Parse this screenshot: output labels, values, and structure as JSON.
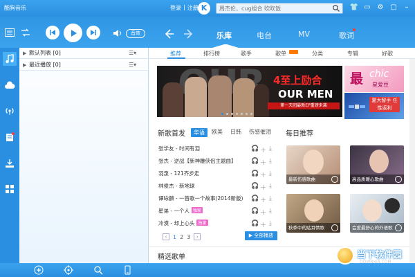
{
  "window": {
    "app_title": "酷狗音乐"
  },
  "account": {
    "login": "登录",
    "sep": "|",
    "register": "注册",
    "logo_letter": "K"
  },
  "search": {
    "placeholder": "周杰伦、cug组合 吹吹饭"
  },
  "player": {
    "sound_effect": "音效"
  },
  "main_tabs": [
    {
      "label": "乐库",
      "active": true
    },
    {
      "label": "电台"
    },
    {
      "label": "MV"
    },
    {
      "label": "歌词"
    }
  ],
  "sidebar_icons": [
    "music-note-icon",
    "cloud-icon",
    "radio-icon",
    "document-icon",
    "download-icon",
    "apps-icon"
  ],
  "playlists": [
    {
      "name": "默认列表",
      "count": "[0]"
    },
    {
      "name": "最近播放",
      "count": "[0]"
    }
  ],
  "sub_tabs": [
    "推荐",
    "排行榜",
    "歌手",
    "歌单",
    "分类",
    "专辑",
    "好歌"
  ],
  "banner": {
    "headline": "4至上励合",
    "subhead": "OUR MEN",
    "strip": "第一天团最新EP重磅来袭",
    "bg_text": "OUR"
  },
  "side_ads": [
    {
      "big": "最",
      "word": "chic",
      "small": "星爱豆"
    },
    {
      "text": "夏大智手 任性返利"
    }
  ],
  "new_songs": {
    "title": "新歌首发",
    "filters": [
      "华语",
      "欧美",
      "日韩",
      "伤感催泪"
    ],
    "items": [
      {
        "title": "张学友 - 时间有泪",
        "tag": ""
      },
      {
        "title": "张杰 - 逆战【新神雕侠侣主题曲】",
        "tag": ""
      },
      {
        "title": "羽泉 - 121齐步走",
        "tag": ""
      },
      {
        "title": "林俊杰 - 新地球",
        "tag": ""
      },
      {
        "title": "谭咏麟 - 一首歌一个故事(2014新版)",
        "tag": ""
      },
      {
        "title": "星弟 - 一个人",
        "tag": "独家"
      },
      {
        "title": "冷漠 - 却上心头",
        "tag": "独家"
      }
    ],
    "pages": [
      "1",
      "2",
      "3"
    ],
    "play_all": "全部播放"
  },
  "recommend": {
    "title": "每日推荐",
    "items": [
      {
        "caption": "最新伤感歌曲"
      },
      {
        "caption": "高品质暖心歌曲"
      },
      {
        "caption": "秋季中的贴耳情歌"
      },
      {
        "caption": "会爱最舒心的外语歌"
      }
    ]
  },
  "playlists_section": {
    "title": "精选歌单"
  },
  "watermark": {
    "line1": "当下软件园",
    "line2": "DOWNXIA.COM"
  },
  "colors": {
    "primary": "#2a8fe0",
    "banner_red": "#ff2a2a",
    "tag_pink": "#f06acd",
    "hot_orange": "#ff7a00"
  }
}
